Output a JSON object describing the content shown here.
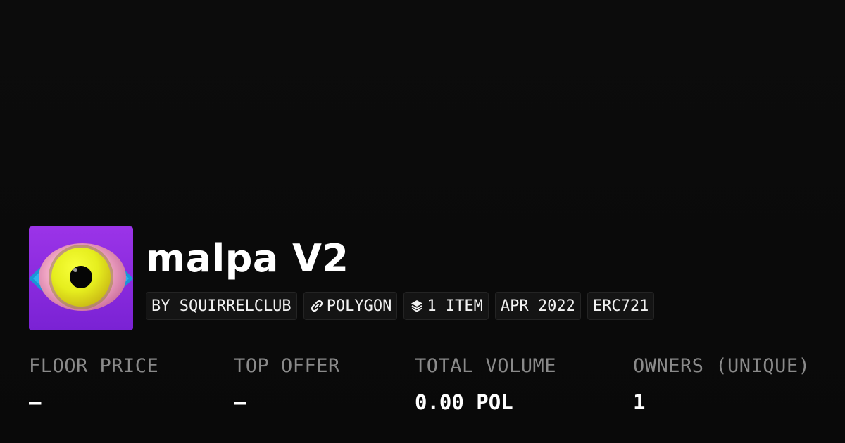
{
  "collection": {
    "title": "malpa V2",
    "avatar_icon": "eye-artwork-icon"
  },
  "tags": [
    {
      "label": "BY SQUIRRELCLUB",
      "icon": null
    },
    {
      "label": "POLYGON",
      "icon": "chain-link-icon"
    },
    {
      "label": "1 ITEM",
      "icon": "layers-icon"
    },
    {
      "label": "APR 2022",
      "icon": null
    },
    {
      "label": "ERC721",
      "icon": null
    }
  ],
  "stats": [
    {
      "label": "FLOOR PRICE",
      "value": "–"
    },
    {
      "label": "TOP OFFER",
      "value": "–"
    },
    {
      "label": "TOTAL VOLUME",
      "value": "0.00 POL"
    },
    {
      "label": "OWNERS (UNIQUE)",
      "value": "1"
    }
  ],
  "colors": {
    "background": "#0b0b0b",
    "label": "#8a8a8a",
    "tag_bg": "#141414",
    "avatar_bg": "#8a2be2"
  }
}
